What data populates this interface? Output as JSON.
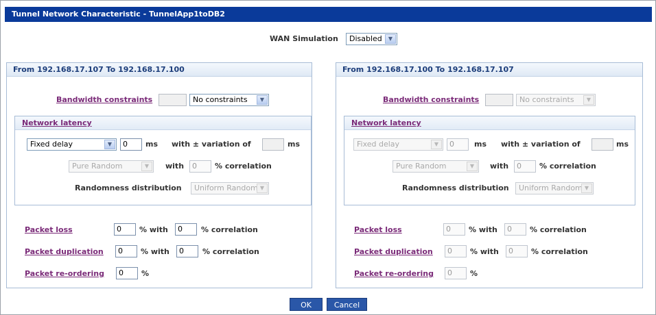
{
  "dialog": {
    "title": "Tunnel Network Characteristic - TunnelApp1toDB2",
    "wan_label": "WAN Simulation",
    "wan_value": "Disabled"
  },
  "left": {
    "header": "From 192.168.17.107 To 192.168.17.100",
    "bandwidth_label": "Bandwidth constraints",
    "bandwidth_value": "",
    "bandwidth_select": "No constraints",
    "latency_label": "Network latency",
    "delay_select": "Fixed delay",
    "delay_value": "0",
    "ms1": "ms",
    "variation_label": "with ± variation of",
    "variation_value": "",
    "ms2": "ms",
    "random_select": "Pure Random",
    "with_label": "with",
    "correlation_value": "0",
    "correlation_label": "% correlation",
    "distribution_label": "Randomness distribution",
    "distribution_select": "Uniform Random",
    "loss_label": "Packet loss",
    "loss_value": "0",
    "loss_with": "% with",
    "loss_corr_value": "0",
    "loss_corr_label": "% correlation",
    "dup_label": "Packet duplication",
    "dup_value": "0",
    "dup_with": "% with",
    "dup_corr_value": "0",
    "dup_corr_label": "% correlation",
    "reorder_label": "Packet re-ordering",
    "reorder_value": "0",
    "reorder_pct": "%"
  },
  "right": {
    "header": "From 192.168.17.100 To 192.168.17.107",
    "bandwidth_label": "Bandwidth constraints",
    "bandwidth_value": "",
    "bandwidth_select": "No constraints",
    "latency_label": "Network latency",
    "delay_select": "Fixed delay",
    "delay_value": "0",
    "ms1": "ms",
    "variation_label": "with ± variation of",
    "variation_value": "",
    "ms2": "ms",
    "random_select": "Pure Random",
    "with_label": "with",
    "correlation_value": "0",
    "correlation_label": "% correlation",
    "distribution_label": "Randomness distribution",
    "distribution_select": "Uniform Random",
    "loss_label": "Packet loss",
    "loss_value": "0",
    "loss_with": "% with",
    "loss_corr_value": "0",
    "loss_corr_label": "% correlation",
    "dup_label": "Packet duplication",
    "dup_value": "0",
    "dup_with": "% with",
    "dup_corr_value": "0",
    "dup_corr_label": "% correlation",
    "reorder_label": "Packet re-ordering",
    "reorder_value": "0",
    "reorder_pct": "%"
  },
  "buttons": {
    "ok": "OK",
    "cancel": "Cancel"
  },
  "icons": {
    "dropdown": "chevron-down-icon"
  },
  "colors": {
    "title_bar": "#0a3a9a",
    "link": "#7a2a78",
    "button": "#2a57a8"
  }
}
